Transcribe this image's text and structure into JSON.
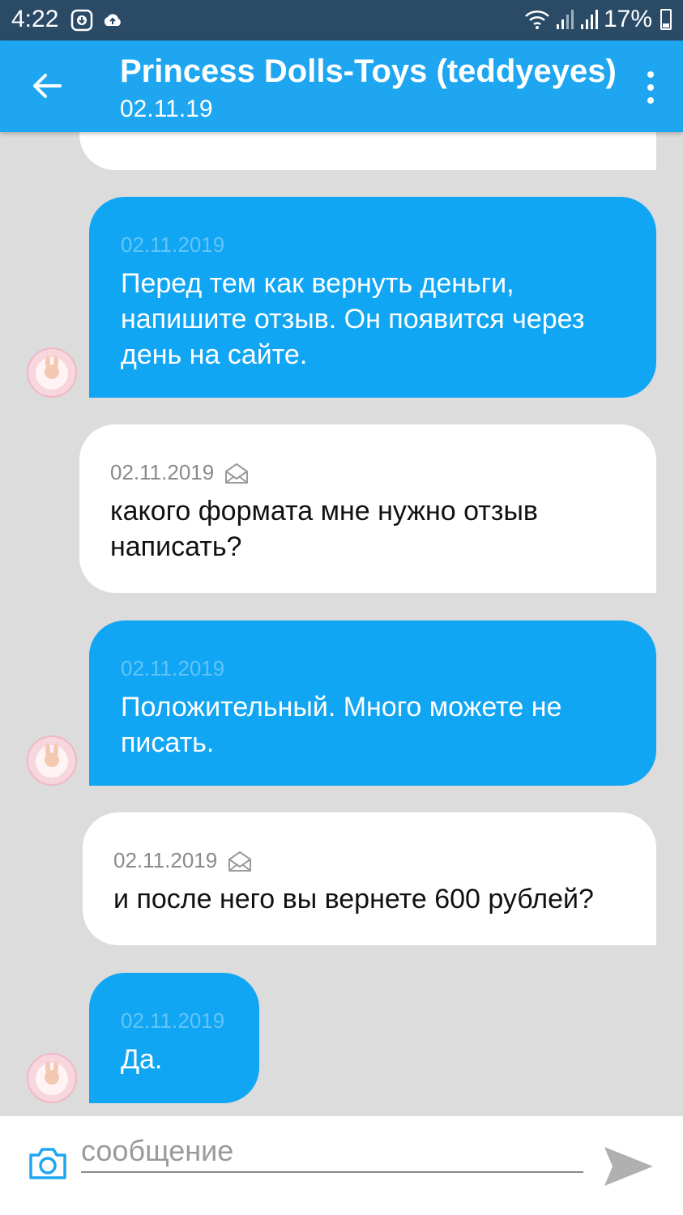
{
  "status_bar": {
    "time": "4:22",
    "battery_label": "17%",
    "icons": [
      "download-circle-icon",
      "cloud-upload-icon",
      "wifi-icon",
      "signal-icon",
      "signal-icon",
      "battery-icon"
    ]
  },
  "header": {
    "title": "Princess Dolls-Toys (teddyeyes)",
    "subtitle": "02.11.19",
    "back_icon": "arrow-left-icon",
    "menu_icon": "more-vert-icon"
  },
  "messages": [
    {
      "direction": "outgoing",
      "date": "02.11.2019",
      "text": "Перед тем как вернуть деньги, напишите отзыв. Он появится через день на сайте."
    },
    {
      "direction": "incoming",
      "date": "02.11.2019",
      "text": "какого формата мне нужно отзыв написать?",
      "status_icon": "envelope-open-icon"
    },
    {
      "direction": "outgoing",
      "date": "02.11.2019",
      "text": "Положительный. Много можете не писать."
    },
    {
      "direction": "incoming",
      "date": "02.11.2019",
      "text": "и после него вы вернете 600 рублей?",
      "status_icon": "envelope-open-icon"
    },
    {
      "direction": "outgoing",
      "date": "02.11.2019",
      "text": "Да."
    }
  ],
  "composer": {
    "placeholder": "сообщение",
    "value": "",
    "camera_icon": "camera-icon",
    "send_icon": "send-icon"
  },
  "colors": {
    "header": "#1ea6f0",
    "status_bar": "#2a4a66",
    "outgoing_bubble": "#11a6f4",
    "incoming_bubble": "#ffffff",
    "chat_background": "#dcdcdc"
  }
}
